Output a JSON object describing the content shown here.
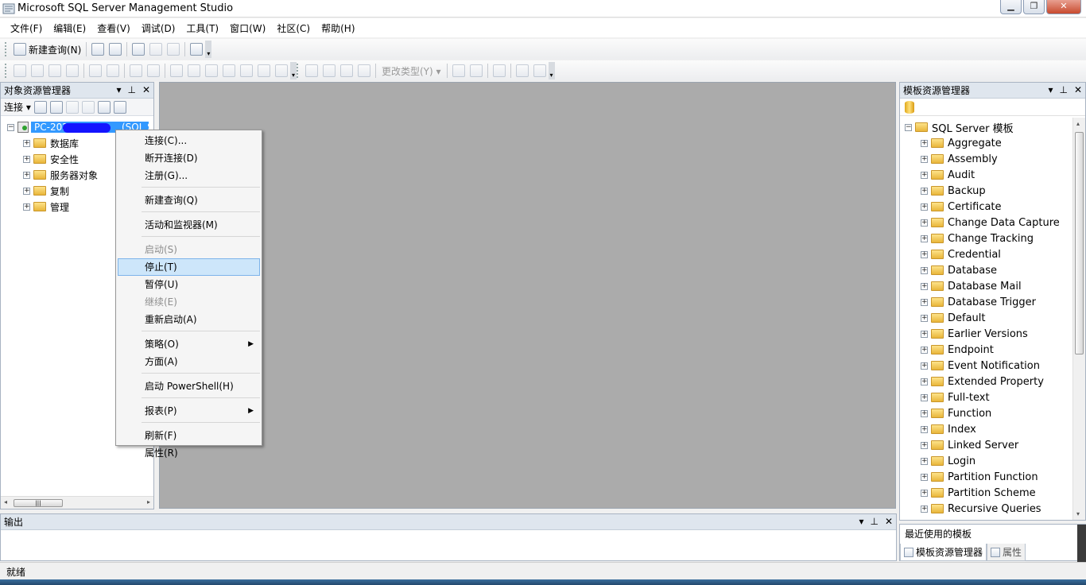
{
  "window": {
    "title": "Microsoft SQL Server Management Studio",
    "buttons": [
      "▁",
      "❐",
      "✕"
    ]
  },
  "menubar": [
    "文件(F)",
    "编辑(E)",
    "查看(V)",
    "调试(D)",
    "工具(T)",
    "窗口(W)",
    "社区(C)",
    "帮助(H)"
  ],
  "toolbar": {
    "new_query": "新建查询(N)",
    "change_type": "更改类型(Y)"
  },
  "object_explorer": {
    "title": "对象资源管理器",
    "connect_label": "连接",
    "server_label": "PC-2020",
    "server_suffix": "(SQL S",
    "nodes": [
      "数据库",
      "安全性",
      "服务器对象",
      "复制",
      "管理"
    ]
  },
  "context_menu": {
    "items": [
      {
        "label": "连接(C)...",
        "state": "normal"
      },
      {
        "label": "断开连接(D)",
        "state": "normal"
      },
      {
        "label": "注册(G)...",
        "state": "normal"
      },
      {
        "label": "新建查询(Q)",
        "state": "normal"
      },
      {
        "label": "活动和监视器(M)",
        "state": "normal"
      },
      {
        "label": "启动(S)",
        "state": "disabled"
      },
      {
        "label": "停止(T)",
        "state": "highlighted"
      },
      {
        "label": "暂停(U)",
        "state": "normal"
      },
      {
        "label": "继续(E)",
        "state": "disabled"
      },
      {
        "label": "重新启动(A)",
        "state": "normal"
      },
      {
        "label": "策略(O)",
        "state": "normal"
      },
      {
        "label": "方面(A)",
        "state": "normal"
      },
      {
        "label": "启动 PowerShell(H)",
        "state": "normal"
      },
      {
        "label": "报表(P)",
        "state": "normal"
      },
      {
        "label": "刷新(F)",
        "state": "normal"
      },
      {
        "label": "属性(R)",
        "state": "normal"
      }
    ]
  },
  "template_explorer": {
    "title": "模板资源管理器",
    "root": "SQL Server 模板",
    "items": [
      "Aggregate",
      "Assembly",
      "Audit",
      "Backup",
      "Certificate",
      "Change Data Capture",
      "Change Tracking",
      "Credential",
      "Database",
      "Database Mail",
      "Database Trigger",
      "Default",
      "Earlier Versions",
      "Endpoint",
      "Event Notification",
      "Extended Property",
      "Full-text",
      "Function",
      "Index",
      "Linked Server",
      "Login",
      "Partition Function",
      "Partition Scheme",
      "Recursive Queries"
    ]
  },
  "recent_templates": {
    "title": "最近使用的模板",
    "tabs": [
      "模板资源管理器",
      "属性"
    ]
  },
  "output": {
    "title": "输出"
  },
  "status": "就绪",
  "colors": {
    "selection": "#3399ff",
    "highlight": "#cde6fa",
    "workspace": "#ababab"
  }
}
